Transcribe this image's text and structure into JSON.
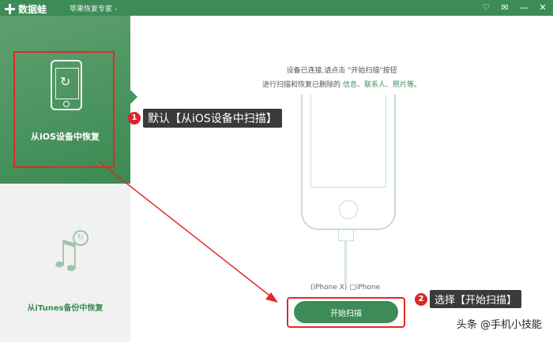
{
  "titlebar": {
    "app_name": "数据蛙",
    "subtitle": "苹果恢复专家 -",
    "controls": [
      "♡",
      "✉",
      "—",
      "✕"
    ]
  },
  "sidebar": {
    "items": [
      {
        "label": "从iOS设备中恢复",
        "icon": "phone-recover-icon",
        "active": true
      },
      {
        "label": "从iTunes备份中恢复",
        "icon": "music-recover-icon",
        "active": false
      }
    ]
  },
  "main": {
    "instruction_line1": "设备已连接,请点击 \"开始扫描\"按钮",
    "instruction_line2_prefix": "进行扫描和恢复已删除的",
    "instruction_highlight": "信息、联系人、照片等。",
    "device_label": "(iPhone X) □iPhone",
    "start_button": "开始扫描"
  },
  "annotations": [
    {
      "num": "1",
      "text": "默认【从iOS设备中扫描】"
    },
    {
      "num": "2",
      "text": "选择【开始扫描】"
    }
  ],
  "watermark": "头条 @手机小技能",
  "colors": {
    "brand_green": "#3d8c58",
    "annotation_red": "#e02a2a"
  }
}
